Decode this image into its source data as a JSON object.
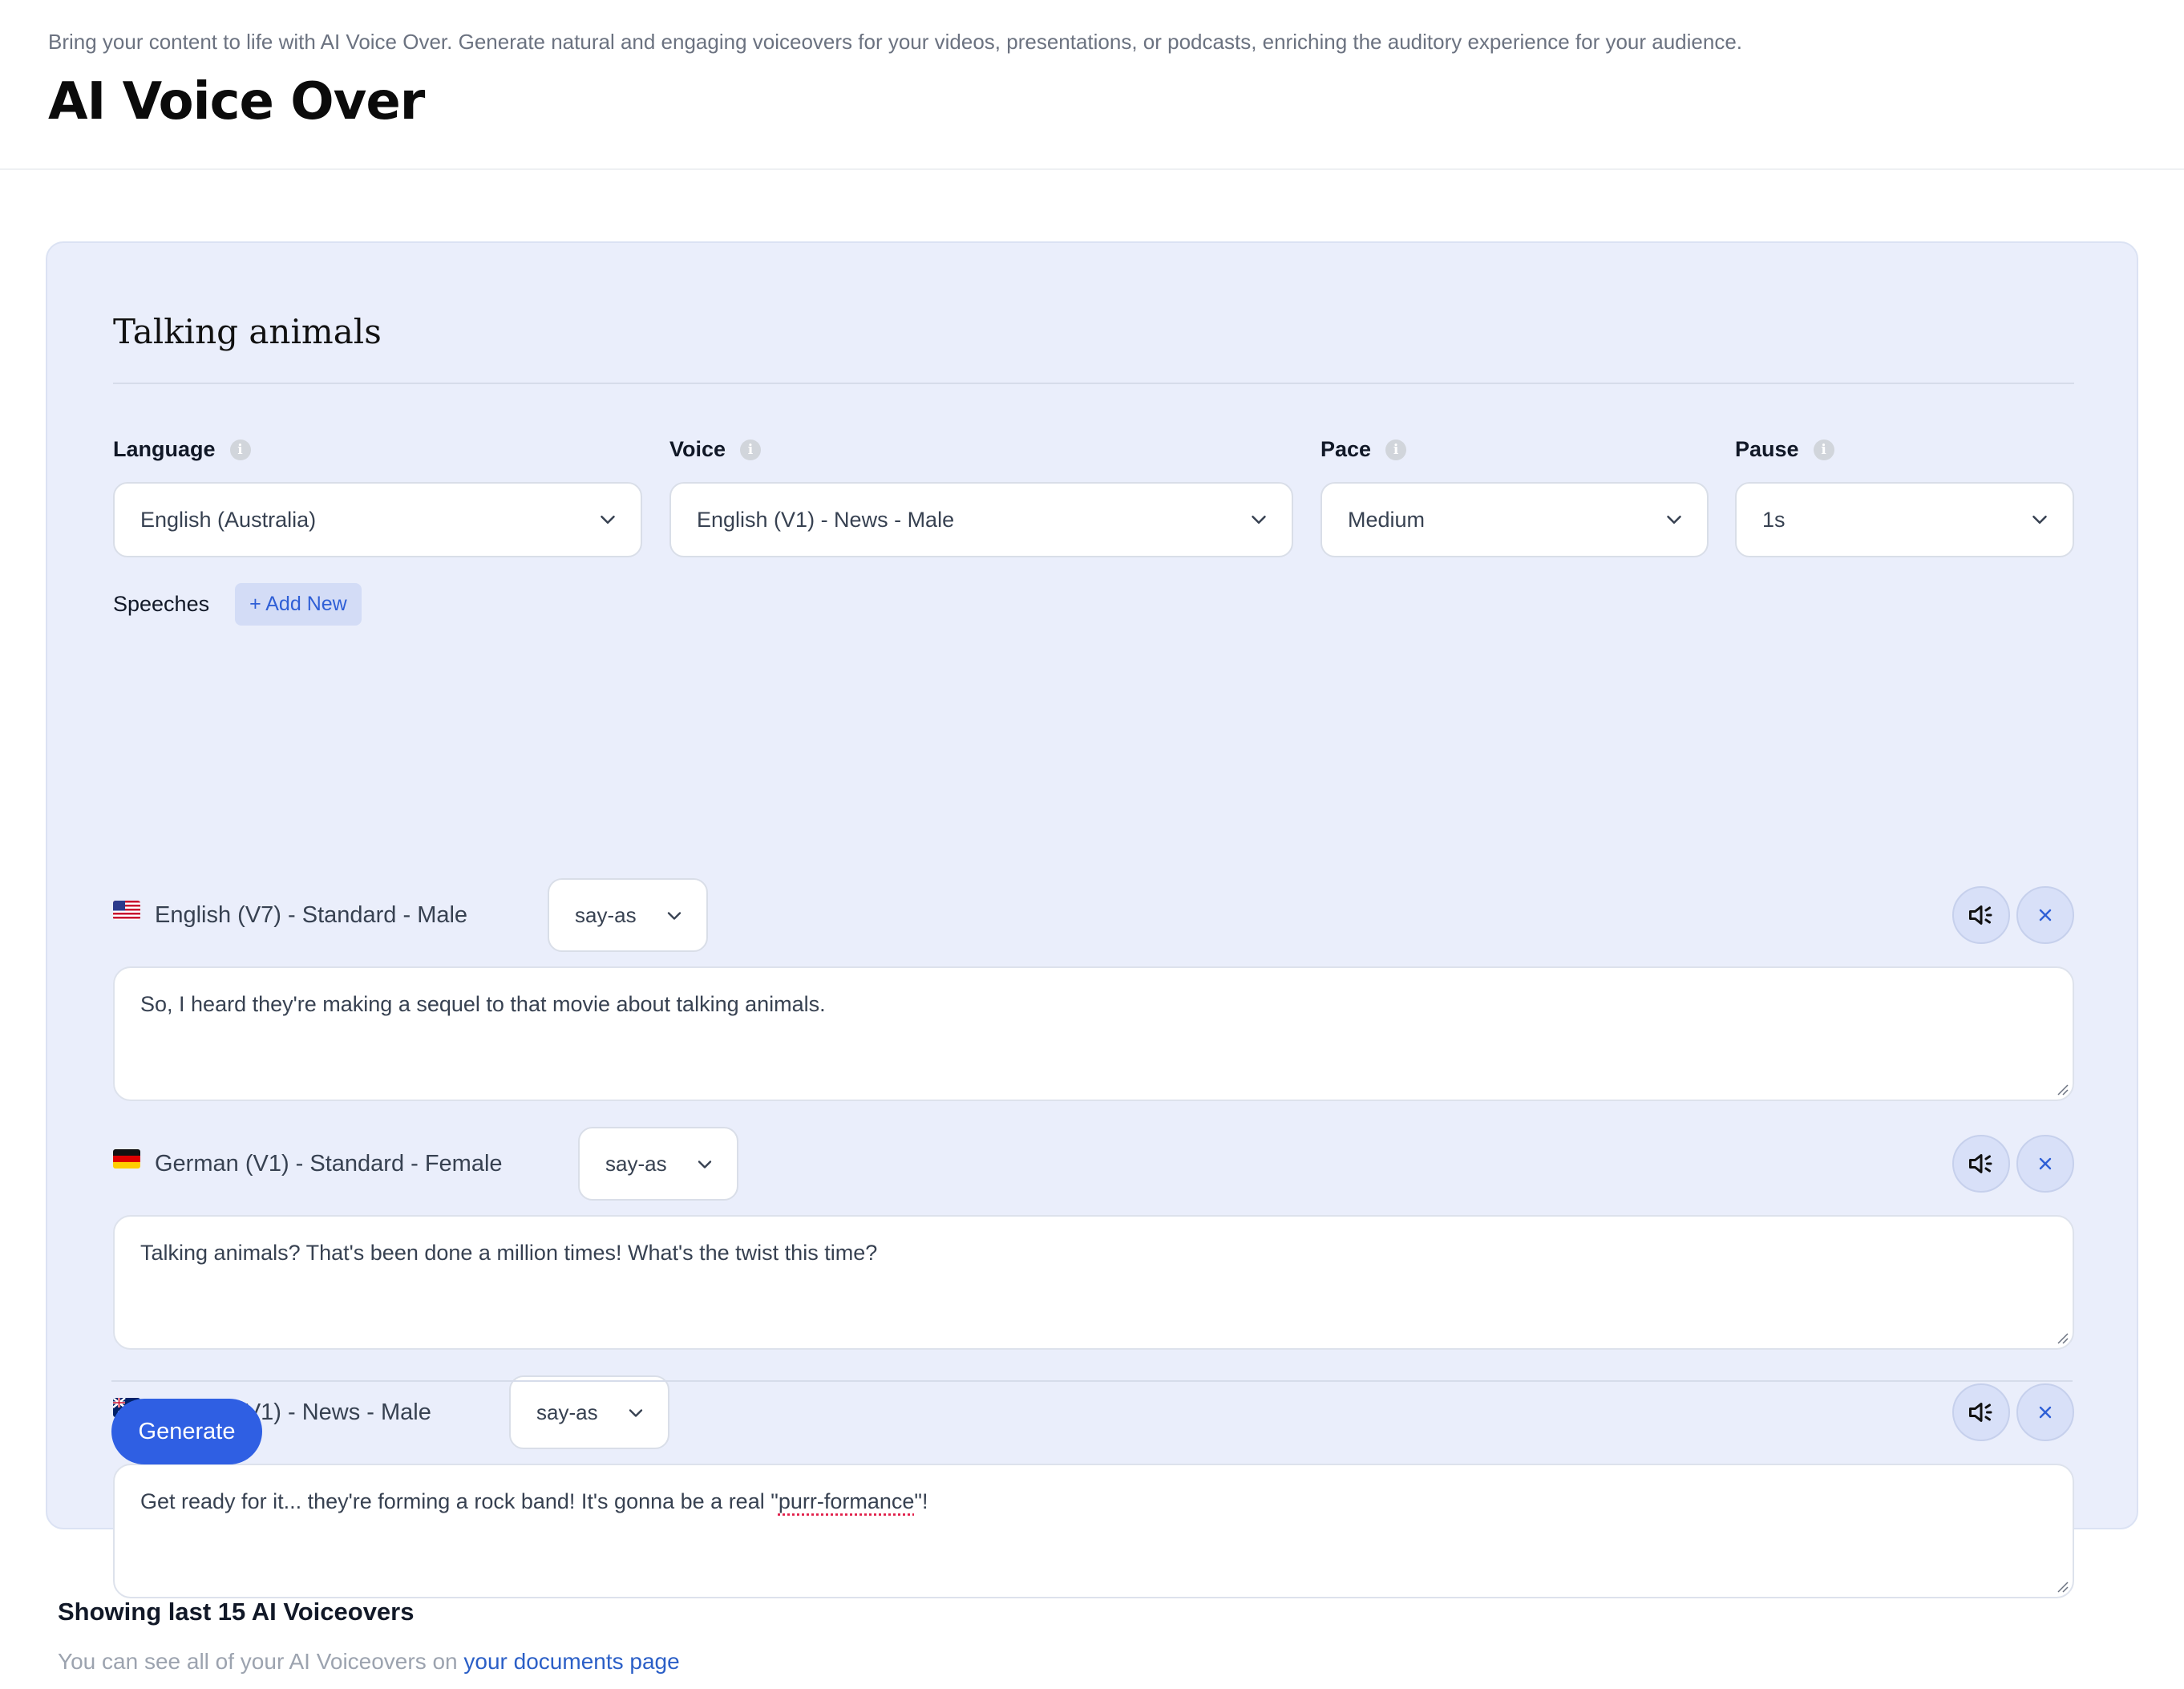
{
  "header": {
    "subtitle": "Bring your content to life with AI Voice Over. Generate natural and engaging voiceovers for your videos, presentations, or podcasts, enriching the auditory experience for your audience.",
    "title": "AI Voice Over"
  },
  "form": {
    "title": "Talking animals",
    "fields": {
      "language": {
        "label": "Language",
        "value": "English (Australia)"
      },
      "voice": {
        "label": "Voice",
        "value": "English (V1) - News - Male"
      },
      "pace": {
        "label": "Pace",
        "value": "Medium"
      },
      "pause": {
        "label": "Pause",
        "value": "1s"
      }
    },
    "speeches_label": "Speeches",
    "add_new_label": "+ Add New",
    "speeches": [
      {
        "flag": "us-flag",
        "voice": "English (V7) - Standard - Male",
        "sayas": "say-as",
        "text": "So, I heard they're making a sequel to that movie about talking animals."
      },
      {
        "flag": "germany-flag",
        "voice": "German (V1) - Standard - Female",
        "sayas": "say-as",
        "text": "Talking animals? That's been done a million times! What's the twist this time?"
      },
      {
        "flag": "australia-flag",
        "voice": "English (V1) - News - Male",
        "sayas": "say-as",
        "text_before": "Get ready for it... they're forming a rock band! It's gonna be a real \"",
        "text_spell": "purr-formance",
        "text_after": "\"!"
      }
    ],
    "generate_label": "Generate"
  },
  "recent": {
    "title": "Showing last 15 AI Voiceovers",
    "sub_prefix": "You can see all of your AI Voiceovers on ",
    "link": "your documents page"
  },
  "colors": {
    "accent": "#2f5fe3",
    "card_bg": "#eaeefb",
    "link": "#2b5fc7"
  }
}
